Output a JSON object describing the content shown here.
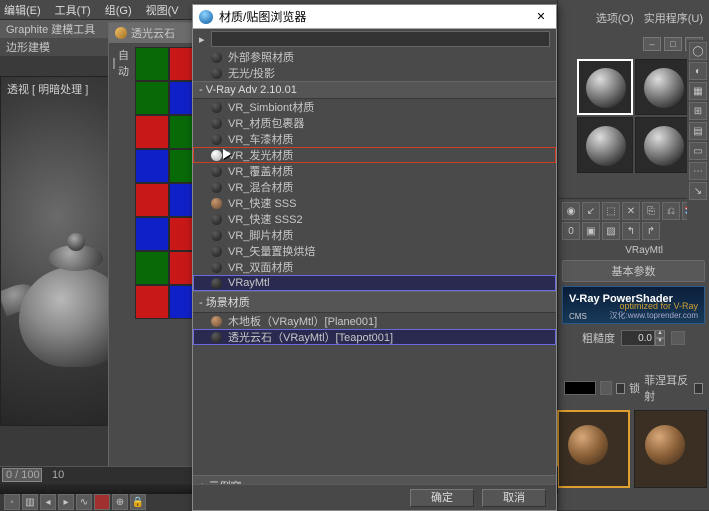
{
  "main_menu": {
    "edit": "编辑(E)",
    "tools": "工具(T)",
    "group": "组(G)",
    "views": "视图(V",
    "options": "选项(O)",
    "util": "实用程序(U)"
  },
  "graphite": {
    "label": "Graphite 建模工具"
  },
  "tabs": {
    "poly": "边形建模"
  },
  "viewport": {
    "label": "透视 [ 明暗处理 ]"
  },
  "mat_editor": {
    "title": "透光云石",
    "auto": "自动"
  },
  "swatches": [
    [
      "#076a07",
      "#c81818"
    ],
    [
      "#076a07",
      "#1020c8"
    ],
    [
      "#c81818",
      "#076a07"
    ],
    [
      "#1020c8",
      "#076a07"
    ],
    [
      "#c81818",
      "#1020c8"
    ],
    [
      "#1020c8",
      "#c81818"
    ],
    [
      "#076a07",
      "#c81818"
    ],
    [
      "#c81818",
      "#1020c8"
    ]
  ],
  "dialog": {
    "title": "材质/贴图浏览器",
    "search_placeholder": "",
    "groups": {
      "builtin": [
        "外部参照材质",
        "无光/投影"
      ],
      "vray_header": "- V-Ray Adv 2.10.01",
      "vray": [
        {
          "label": "VR_Simbiont材质",
          "ball": "dark"
        },
        {
          "label": "VR_材质包裹器",
          "ball": "dark"
        },
        {
          "label": "VR_车漆材质",
          "ball": "dark"
        },
        {
          "label": "VR_发光材质",
          "ball": "white",
          "hl": true
        },
        {
          "label": "VR_覆盖材质",
          "ball": "dark"
        },
        {
          "label": "VR_混合材质",
          "ball": "dark"
        },
        {
          "label": "VR_快速 SSS",
          "ball": "wood"
        },
        {
          "label": "VR_快速 SSS2",
          "ball": "dark"
        },
        {
          "label": "VR_脚片材质",
          "ball": "dark"
        },
        {
          "label": "VR_矢量置换烘焙",
          "ball": "dark"
        },
        {
          "label": "VR_双面材质",
          "ball": "dark"
        },
        {
          "label": "VRayMtl",
          "ball": "dark",
          "sel": true
        }
      ],
      "scene_header": "- 场景材质",
      "scene": [
        {
          "label": "木地板（VRayMtl）[Plane001]",
          "ball": "wood"
        },
        {
          "label": "透光云石（VRayMtl）[Teapot001]",
          "ball": "dark",
          "sel": true
        }
      ],
      "sample_header": "+ 示例窗"
    },
    "ok": "确定",
    "cancel": "取消"
  },
  "right": {
    "menu_options": "选项(O)",
    "menu_util": "实用程序(U)",
    "mtl_label": "VRayMtl",
    "rollout_basic": "基本参数",
    "banner_title": "V-Ray PowerShader",
    "banner_sub": "optimized for V-Ray",
    "banner_url": "汉化:www.toprender.com",
    "banner_cms": "CMS",
    "rough_label": "粗糙度",
    "rough_val": "0.0",
    "chk_fresnel_lock": "锁",
    "chk_fresnel": "菲涅耳反射"
  },
  "timeline": {
    "range": "0 / 100",
    "tick": "10"
  }
}
